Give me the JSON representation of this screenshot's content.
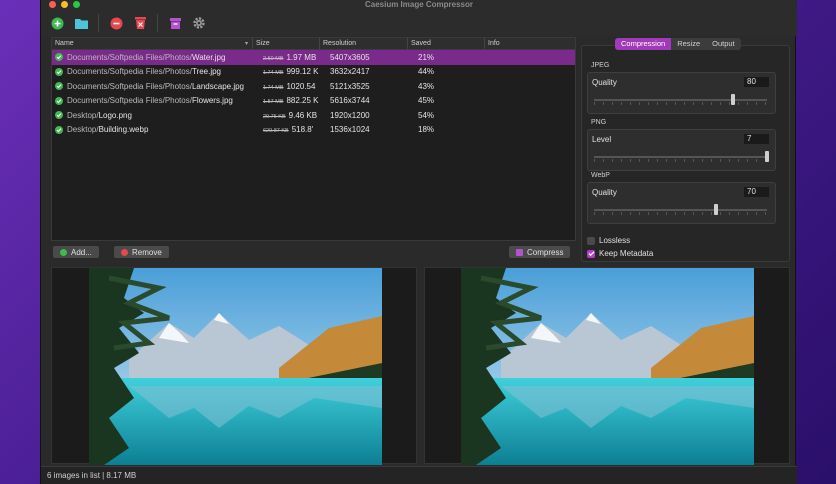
{
  "window": {
    "title": "Caesium Image Compressor"
  },
  "toolbar": {
    "add_icon": "plus-circle-icon",
    "folder_icon": "folder-icon",
    "remove_icon": "minus-circle-icon",
    "clear_icon": "trash-icon",
    "archive_icon": "archive-icon",
    "settings_icon": "gear-icon"
  },
  "table": {
    "headers": {
      "name": "Name",
      "size": "Size",
      "resolution": "Resolution",
      "saved": "Saved",
      "info": "Info"
    },
    "rows": [
      {
        "dir": "Documents/Softpedia Files/Photos/",
        "file": "Water.jpg",
        "old_size": "2.50 MB",
        "new_size": "1.97 MB",
        "resolution": "5407x3605",
        "saved": "21%"
      },
      {
        "dir": "Documents/Softpedia Files/Photos/",
        "file": "Tree.jpg",
        "old_size": "1.74 MB",
        "new_size": "999.12 K",
        "resolution": "3632x2417",
        "saved": "44%"
      },
      {
        "dir": "Documents/Softpedia Files/Photos/",
        "file": "Landscape.jpg",
        "old_size": "1.74 MB",
        "new_size": "1020.54",
        "resolution": "5121x3525",
        "saved": "43%"
      },
      {
        "dir": "Documents/Softpedia Files/Photos/",
        "file": "Flowers.jpg",
        "old_size": "1.57 MB",
        "new_size": "882.25 K",
        "resolution": "5616x3744",
        "saved": "45%"
      },
      {
        "dir": "Desktop/",
        "file": "Logo.png",
        "old_size": "20.75 KB",
        "new_size": "9.46 KB",
        "resolution": "1920x1200",
        "saved": "54%"
      },
      {
        "dir": "Desktop/",
        "file": "Building.webp",
        "old_size": "629.87 KB",
        "new_size": "518.8'",
        "resolution": "1536x1024",
        "saved": "18%"
      }
    ]
  },
  "buttons": {
    "add": "Add...",
    "remove": "Remove",
    "compress": "Compress"
  },
  "tabs": [
    "Compression",
    "Resize",
    "Output"
  ],
  "jpeg": {
    "section": "JPEG",
    "label": "Quality",
    "value": "80",
    "level": 0.8
  },
  "png": {
    "section": "PNG",
    "label": "Level",
    "value": "7",
    "level": 1.0
  },
  "webp": {
    "section": "WebP",
    "label": "Quality",
    "value": "70",
    "level": 0.7
  },
  "options": {
    "lossless": "Lossless",
    "keep_metadata": "Keep Metadata",
    "lossless_checked": false,
    "keep_metadata_checked": true
  },
  "status": {
    "text": "6 images in list | 8.17 MB"
  },
  "colors": {
    "accent": "#a03ab8",
    "selected_row": "#7a2a8a",
    "ok_green": "#3fb950"
  }
}
